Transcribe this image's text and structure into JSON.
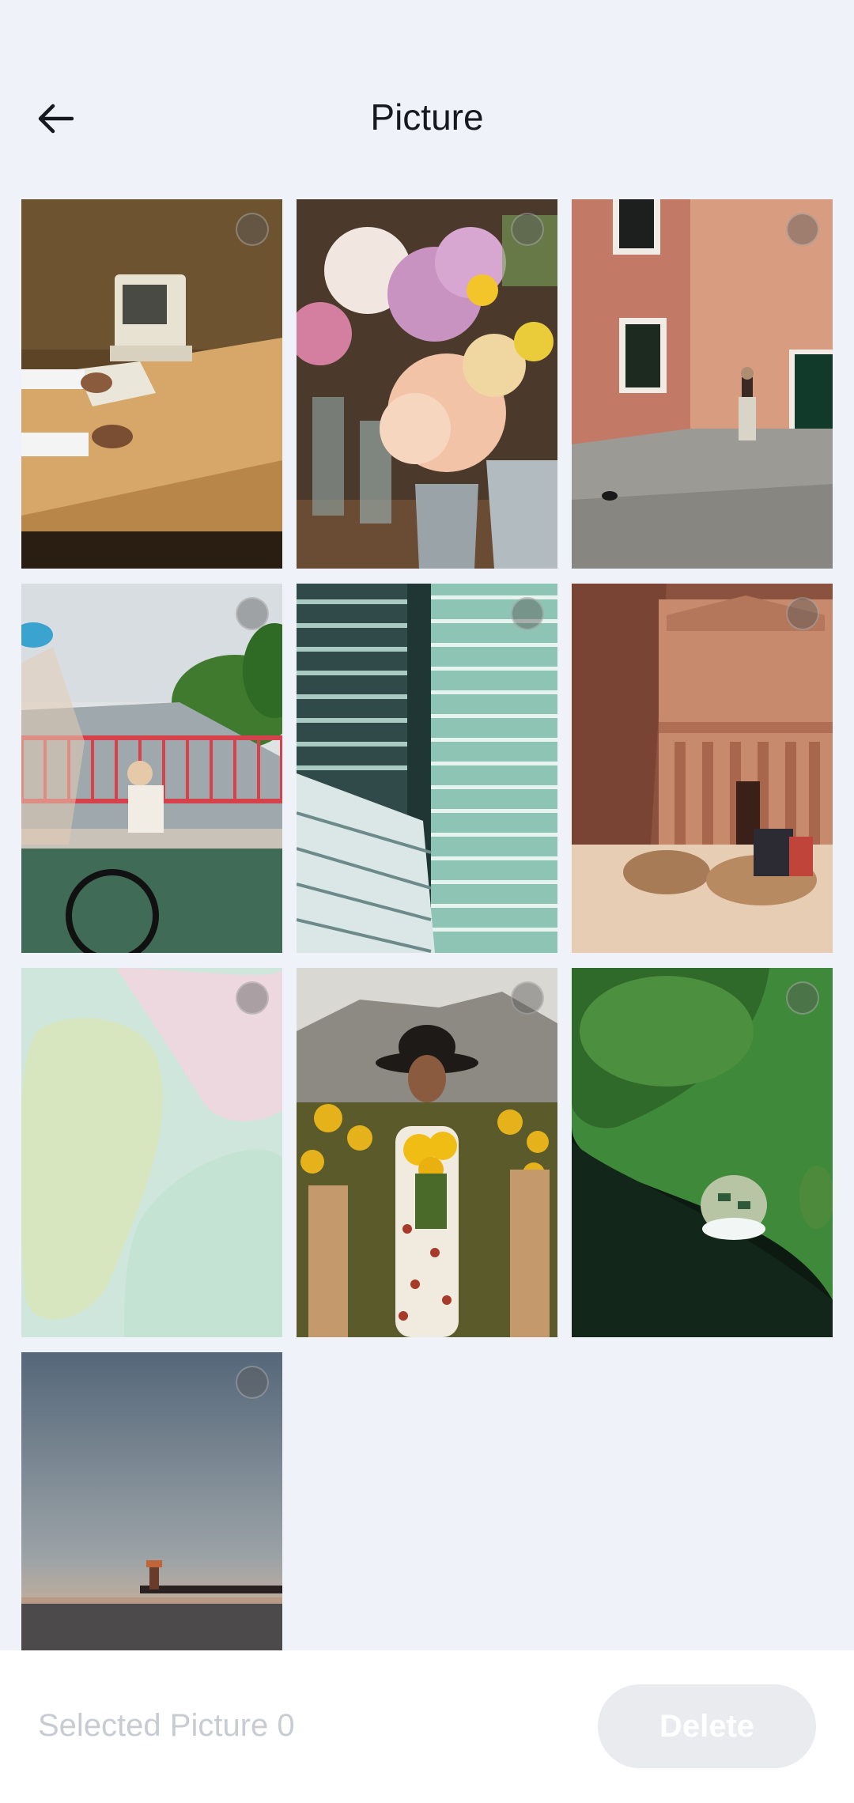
{
  "header": {
    "title": "Picture",
    "back_icon": "arrow-left-icon"
  },
  "photos": [
    {
      "name": "vintage-computer-photo",
      "selected": false
    },
    {
      "name": "flower-buckets-photo",
      "selected": false
    },
    {
      "name": "venice-street-photo",
      "selected": false
    },
    {
      "name": "bridge-cyclist-photo",
      "selected": false
    },
    {
      "name": "glass-tower-photo",
      "selected": false
    },
    {
      "name": "petra-camels-photo",
      "selected": false
    },
    {
      "name": "pastel-abstract-photo",
      "selected": false
    },
    {
      "name": "sunflower-woman-photo",
      "selected": false
    },
    {
      "name": "aerial-island-photo",
      "selected": false
    },
    {
      "name": "lighthouse-dusk-photo",
      "selected": false
    }
  ],
  "footer": {
    "selected_label": "Selected Picture 0",
    "delete_label": "Delete"
  },
  "colors": {
    "background": "#eff2f8",
    "title": "#16191f",
    "disabled_text": "#c8ccd2",
    "disabled_button": "#e9ebee"
  }
}
